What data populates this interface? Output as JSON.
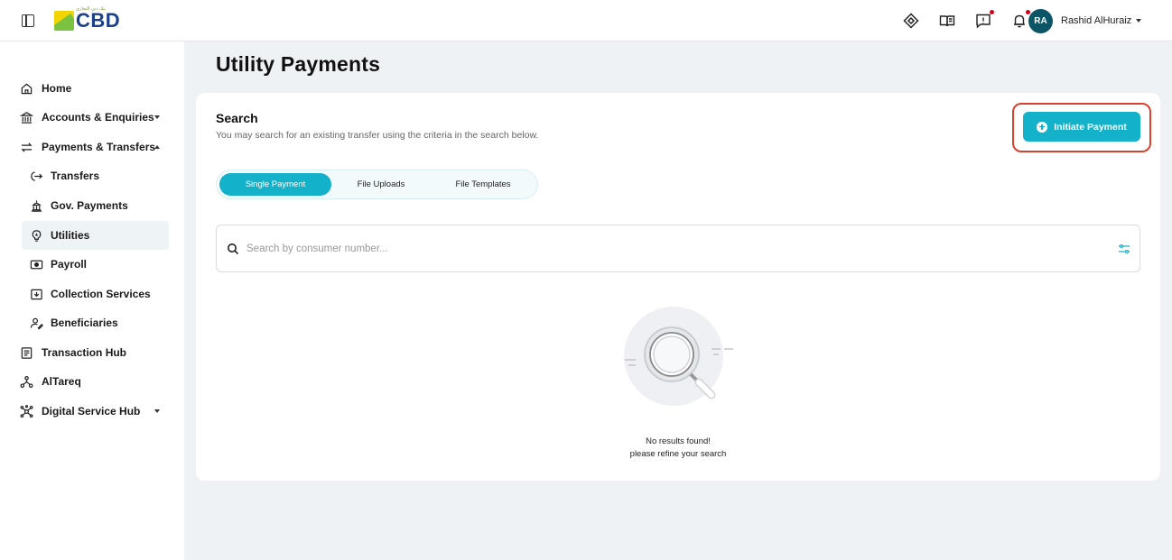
{
  "header": {
    "logo_text": "CBD",
    "logo_subtext": "بنك دبي التجاري",
    "user_initials": "RA",
    "user_name": "Rashid AlHuraiz"
  },
  "sidebar": {
    "items": [
      {
        "label": "Home",
        "icon": "home-icon"
      },
      {
        "label": "Accounts & Enquiries",
        "icon": "bank-icon",
        "expandable": true
      },
      {
        "label": "Payments & Transfers",
        "icon": "transfer-arrows-icon",
        "expanded": true
      },
      {
        "label": "Transfers",
        "icon": "exit-arrow-icon"
      },
      {
        "label": "Gov. Payments",
        "icon": "government-building-icon"
      },
      {
        "label": "Utilities",
        "icon": "lightbulb-icon",
        "active": true
      },
      {
        "label": "Payroll",
        "icon": "cash-icon"
      },
      {
        "label": "Collection Services",
        "icon": "download-box-icon"
      },
      {
        "label": "Beneficiaries",
        "icon": "user-edit-icon"
      },
      {
        "label": "Transaction Hub",
        "icon": "document-list-icon"
      },
      {
        "label": "AlTareq",
        "icon": "network-icon"
      },
      {
        "label": "Digital Service Hub",
        "icon": "hub-nodes-icon",
        "expandable": true
      }
    ]
  },
  "main": {
    "page_title": "Utility Payments",
    "search_section": {
      "title": "Search",
      "subtitle": "You may search for an existing transfer using the criteria in the search below.",
      "initiate_label": "Initiate Payment",
      "tabs": [
        {
          "label": "Single Payment",
          "active": true
        },
        {
          "label": "File Uploads"
        },
        {
          "label": "File Templates"
        }
      ],
      "search_placeholder": "Search by consumer number...",
      "empty_line1": "No results found!",
      "empty_line2": "please refine your search"
    }
  },
  "colors": {
    "accent": "#14b1ca",
    "highlight_border": "#d9412e",
    "avatar_bg": "#0c5566",
    "notification_dot": "#d0021b"
  }
}
